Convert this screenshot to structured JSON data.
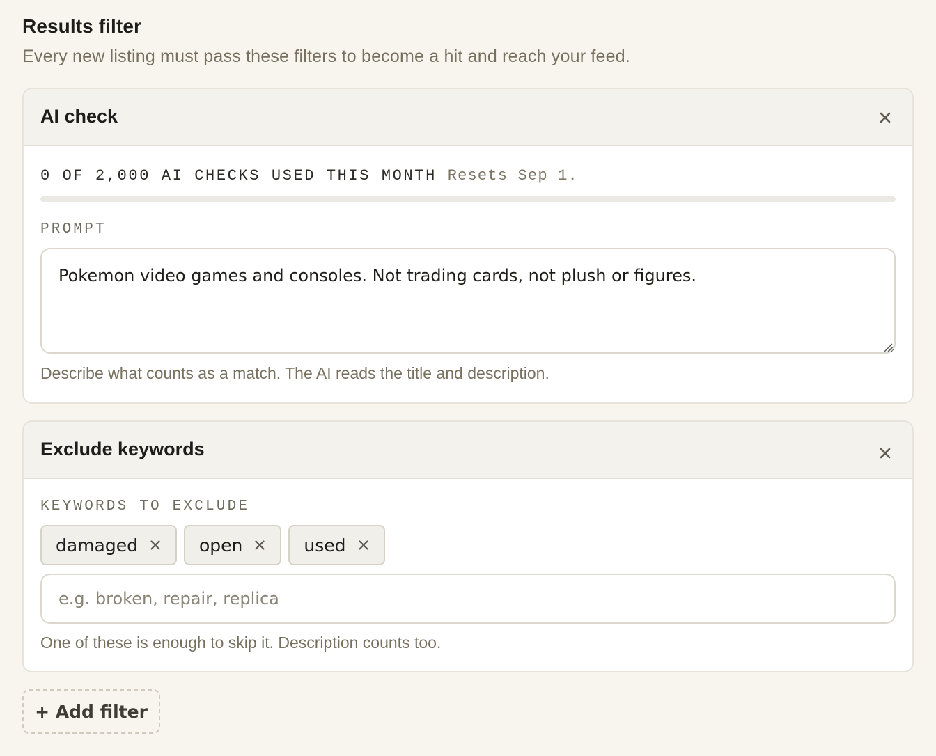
{
  "section": {
    "title": "Results filter",
    "subtitle": "Every new listing must pass these filters to become a hit and reach your feed."
  },
  "ai_check": {
    "title": "AI check",
    "usage_count": "0 OF 2,000 AI CHECKS USED THIS MONTH",
    "usage_reset": "Resets Sep 1.",
    "usage_used": 0,
    "usage_limit": 2000,
    "prompt_label": "PROMPT",
    "prompt_value": "Pokemon video games and consoles. Not trading cards, not plush or figures.",
    "help": "Describe what counts as a match. The AI reads the title and description."
  },
  "exclude_keywords": {
    "title": "Exclude keywords",
    "label": "KEYWORDS TO EXCLUDE",
    "chips": [
      "damaged",
      "open",
      "used"
    ],
    "input_placeholder": "e.g. broken, repair, replica",
    "help": "One of these is enough to skip it. Description counts too."
  },
  "add_filter_label": "+ Add filter",
  "icons": {
    "close": "close-icon",
    "chip_remove": "close-icon"
  },
  "colors": {
    "background": "#f8f5ee",
    "card_header": "#f3f2ed",
    "muted_text": "#77705f"
  }
}
